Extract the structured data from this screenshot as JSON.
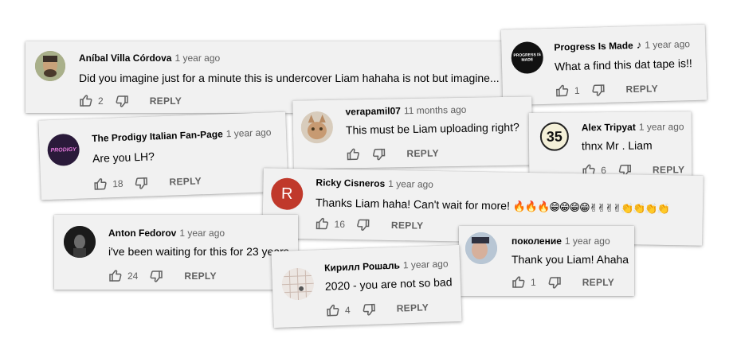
{
  "comments": [
    {
      "name": "Aníbal Villa Córdova",
      "time": "1 year ago",
      "text": "Did you imagine just for a minute this is undercover Liam hahaha is not but imagine...",
      "likes": "2",
      "reply": "REPLY"
    },
    {
      "name": "Progress Is Made",
      "note": "♪",
      "time": "1 year ago",
      "text": "What a find this dat tape is!!",
      "likes": "1",
      "reply": "REPLY",
      "avatar_text": "PROGRESS IS MADE"
    },
    {
      "name": "verapamil07",
      "time": "11 months ago",
      "text": "This must be Liam uploading right?",
      "likes": "",
      "reply": "REPLY"
    },
    {
      "name": "The Prodigy Italian Fan-Page",
      "time": "1 year ago",
      "text": "Are you LH?",
      "likes": "18",
      "reply": "REPLY",
      "avatar_text": "PRODIGY"
    },
    {
      "name": "Alex Tripyat",
      "time": "1 year ago",
      "text": "thnx Mr . Liam",
      "likes": "6",
      "reply": "REPLY",
      "avatar_text": "35"
    },
    {
      "name": "Ricky Cisneros",
      "time": "1 year ago",
      "text": "Thanks Liam haha! Can't wait for more!",
      "emoji": "🔥🔥🔥😁😁😁😁✌✌✌✌👏👏👏👏",
      "likes": "16",
      "reply": "REPLY",
      "avatar_text": "R"
    },
    {
      "name": "Anton Fedorov",
      "time": "1 year ago",
      "text": "i've been waiting for this for 23 years",
      "likes": "24",
      "reply": "REPLY"
    },
    {
      "name": "поколение",
      "time": "1 year ago",
      "text": "Thank you Liam! Ahaha",
      "likes": "1",
      "reply": "REPLY"
    },
    {
      "name": "Кирилл Рошаль",
      "time": "1 year ago",
      "text": "2020 - you are not so bad",
      "likes": "4",
      "reply": "REPLY"
    }
  ],
  "colors": {
    "card_bg": "#f1f1f1",
    "name": "#030303",
    "meta": "#606060",
    "ricky_avatar": "#c0392b"
  },
  "icons": {
    "like": "thumbs-up-icon",
    "dislike": "thumbs-down-icon"
  }
}
